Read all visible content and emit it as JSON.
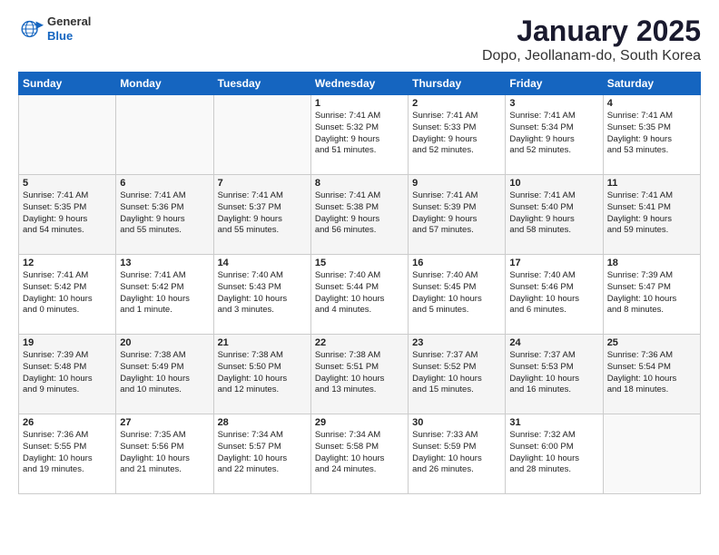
{
  "header": {
    "logo_general": "General",
    "logo_blue": "Blue",
    "title": "January 2025",
    "subtitle": "Dopo, Jeollanam-do, South Korea"
  },
  "days_of_week": [
    "Sunday",
    "Monday",
    "Tuesday",
    "Wednesday",
    "Thursday",
    "Friday",
    "Saturday"
  ],
  "weeks": [
    [
      {
        "day": "",
        "info": ""
      },
      {
        "day": "",
        "info": ""
      },
      {
        "day": "",
        "info": ""
      },
      {
        "day": "1",
        "info": "Sunrise: 7:41 AM\nSunset: 5:32 PM\nDaylight: 9 hours\nand 51 minutes."
      },
      {
        "day": "2",
        "info": "Sunrise: 7:41 AM\nSunset: 5:33 PM\nDaylight: 9 hours\nand 52 minutes."
      },
      {
        "day": "3",
        "info": "Sunrise: 7:41 AM\nSunset: 5:34 PM\nDaylight: 9 hours\nand 52 minutes."
      },
      {
        "day": "4",
        "info": "Sunrise: 7:41 AM\nSunset: 5:35 PM\nDaylight: 9 hours\nand 53 minutes."
      }
    ],
    [
      {
        "day": "5",
        "info": "Sunrise: 7:41 AM\nSunset: 5:35 PM\nDaylight: 9 hours\nand 54 minutes."
      },
      {
        "day": "6",
        "info": "Sunrise: 7:41 AM\nSunset: 5:36 PM\nDaylight: 9 hours\nand 55 minutes."
      },
      {
        "day": "7",
        "info": "Sunrise: 7:41 AM\nSunset: 5:37 PM\nDaylight: 9 hours\nand 55 minutes."
      },
      {
        "day": "8",
        "info": "Sunrise: 7:41 AM\nSunset: 5:38 PM\nDaylight: 9 hours\nand 56 minutes."
      },
      {
        "day": "9",
        "info": "Sunrise: 7:41 AM\nSunset: 5:39 PM\nDaylight: 9 hours\nand 57 minutes."
      },
      {
        "day": "10",
        "info": "Sunrise: 7:41 AM\nSunset: 5:40 PM\nDaylight: 9 hours\nand 58 minutes."
      },
      {
        "day": "11",
        "info": "Sunrise: 7:41 AM\nSunset: 5:41 PM\nDaylight: 9 hours\nand 59 minutes."
      }
    ],
    [
      {
        "day": "12",
        "info": "Sunrise: 7:41 AM\nSunset: 5:42 PM\nDaylight: 10 hours\nand 0 minutes."
      },
      {
        "day": "13",
        "info": "Sunrise: 7:41 AM\nSunset: 5:42 PM\nDaylight: 10 hours\nand 1 minute."
      },
      {
        "day": "14",
        "info": "Sunrise: 7:40 AM\nSunset: 5:43 PM\nDaylight: 10 hours\nand 3 minutes."
      },
      {
        "day": "15",
        "info": "Sunrise: 7:40 AM\nSunset: 5:44 PM\nDaylight: 10 hours\nand 4 minutes."
      },
      {
        "day": "16",
        "info": "Sunrise: 7:40 AM\nSunset: 5:45 PM\nDaylight: 10 hours\nand 5 minutes."
      },
      {
        "day": "17",
        "info": "Sunrise: 7:40 AM\nSunset: 5:46 PM\nDaylight: 10 hours\nand 6 minutes."
      },
      {
        "day": "18",
        "info": "Sunrise: 7:39 AM\nSunset: 5:47 PM\nDaylight: 10 hours\nand 8 minutes."
      }
    ],
    [
      {
        "day": "19",
        "info": "Sunrise: 7:39 AM\nSunset: 5:48 PM\nDaylight: 10 hours\nand 9 minutes."
      },
      {
        "day": "20",
        "info": "Sunrise: 7:38 AM\nSunset: 5:49 PM\nDaylight: 10 hours\nand 10 minutes."
      },
      {
        "day": "21",
        "info": "Sunrise: 7:38 AM\nSunset: 5:50 PM\nDaylight: 10 hours\nand 12 minutes."
      },
      {
        "day": "22",
        "info": "Sunrise: 7:38 AM\nSunset: 5:51 PM\nDaylight: 10 hours\nand 13 minutes."
      },
      {
        "day": "23",
        "info": "Sunrise: 7:37 AM\nSunset: 5:52 PM\nDaylight: 10 hours\nand 15 minutes."
      },
      {
        "day": "24",
        "info": "Sunrise: 7:37 AM\nSunset: 5:53 PM\nDaylight: 10 hours\nand 16 minutes."
      },
      {
        "day": "25",
        "info": "Sunrise: 7:36 AM\nSunset: 5:54 PM\nDaylight: 10 hours\nand 18 minutes."
      }
    ],
    [
      {
        "day": "26",
        "info": "Sunrise: 7:36 AM\nSunset: 5:55 PM\nDaylight: 10 hours\nand 19 minutes."
      },
      {
        "day": "27",
        "info": "Sunrise: 7:35 AM\nSunset: 5:56 PM\nDaylight: 10 hours\nand 21 minutes."
      },
      {
        "day": "28",
        "info": "Sunrise: 7:34 AM\nSunset: 5:57 PM\nDaylight: 10 hours\nand 22 minutes."
      },
      {
        "day": "29",
        "info": "Sunrise: 7:34 AM\nSunset: 5:58 PM\nDaylight: 10 hours\nand 24 minutes."
      },
      {
        "day": "30",
        "info": "Sunrise: 7:33 AM\nSunset: 5:59 PM\nDaylight: 10 hours\nand 26 minutes."
      },
      {
        "day": "31",
        "info": "Sunrise: 7:32 AM\nSunset: 6:00 PM\nDaylight: 10 hours\nand 28 minutes."
      },
      {
        "day": "",
        "info": ""
      }
    ]
  ]
}
